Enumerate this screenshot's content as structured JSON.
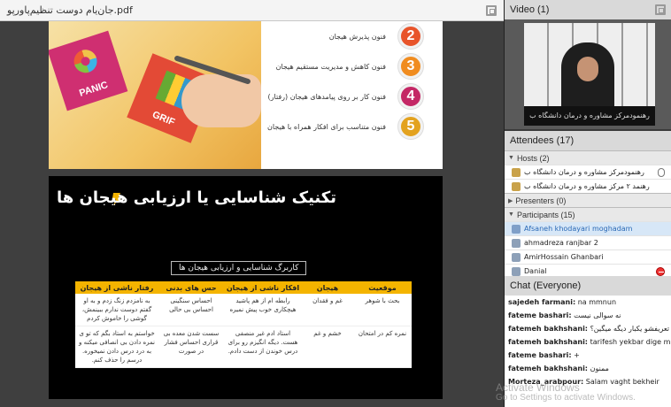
{
  "document": {
    "title": "جان‌یام دوست تنظیم‌پاورپو.pdf",
    "slide1": {
      "cards": [
        "PANIC",
        "GRIF"
      ],
      "steps": [
        {
          "num": "2",
          "label": "فنون پذیرش هیجان",
          "color": "#e8542a"
        },
        {
          "num": "3",
          "label": "فنون کاهش و مدیریت مستقیم هیجان",
          "color": "#f08c1f"
        },
        {
          "num": "4",
          "label": "فنون کار بر روی پیامدهای هیجان (رفتار)",
          "color": "#c42765"
        },
        {
          "num": "5",
          "label": "فنون متناسب برای افکار همراه با هیجان",
          "color": "#e3a21f"
        }
      ]
    },
    "slide2": {
      "title": "تکنیک شناسایی یا ارزیابی هیجان ها",
      "subtitle": "کاربرگ شناسایی و ارزیابی هیجان ها",
      "headers": [
        "موقعیت",
        "هیجان",
        "افکار ناشی از هیجان",
        "حس های بدنی",
        "رفتار ناشی از هیجان"
      ],
      "rows": [
        [
          "بحث با شوهر",
          "غم و فقدان",
          "رابطه ام از هم پاشید هیچکاری خوب پیش نمیره",
          "احساس سنگینی احساس بی حالی",
          "به نامزدم زنگ زدم و به او گفتم دوست ندارم ببینمش، گوشی را خاموش کردم"
        ],
        [
          "نمره کم در امتحان",
          "خشم و غم",
          "استاد ادم غیر منصفی هست. دیگه انگیزم رو برای درس خوندن از دست دادم.",
          "سست شدن معده بی قراری احساس فشار در صورت",
          "خواستم به استاد بگم که تو ی نمره دادن بی انصافی میکنه و به درد درس دادن نمیخوره. درسم را حذف کنم."
        ]
      ]
    }
  },
  "video": {
    "header": "Video",
    "count": "(1)",
    "caption": "رهنمودمرکز مشاوره و درمان دانشگاه ب"
  },
  "attendees": {
    "header": "Attendees",
    "count": "(17)",
    "hosts_label": "Hosts (2)",
    "hosts": [
      "رهنمودمرکز مشاوره و درمان دانشگاه ب",
      "رهنمد ۲ مرکز مشاوره و درمان دانشگاه ب"
    ],
    "presenters_label": "Presenters (0)",
    "participants_label": "Participants (15)",
    "participants": [
      "Afsaneh khodayari moghadam",
      "ahmadreza ranjbar 2",
      "AmirHossain Ghanbari",
      "Danial"
    ]
  },
  "chat": {
    "header": "Chat",
    "scope": "(Everyone)",
    "messages": [
      {
        "name": "sajedeh farmani:",
        "text": "na mmnun"
      },
      {
        "name": "fateme bashari:",
        "text": "نه سوالی نیست"
      },
      {
        "name": "fatemeh bakhshani:",
        "text": "تعریفشو یکبار دیگه میگین؟"
      },
      {
        "name": "fatemeh bakhshani:",
        "text": "tarifesh yekbar dige migin?"
      },
      {
        "name": "fateme bashari:",
        "text": "+"
      },
      {
        "name": "fatemeh bakhshani:",
        "text": "ممنون"
      },
      {
        "name": "Morteza_arabpour:",
        "text": "Salam vaght bekheir"
      }
    ]
  },
  "watermark": {
    "line1": "Activate Windows",
    "line2": "Go to Settings to activate Windows."
  }
}
